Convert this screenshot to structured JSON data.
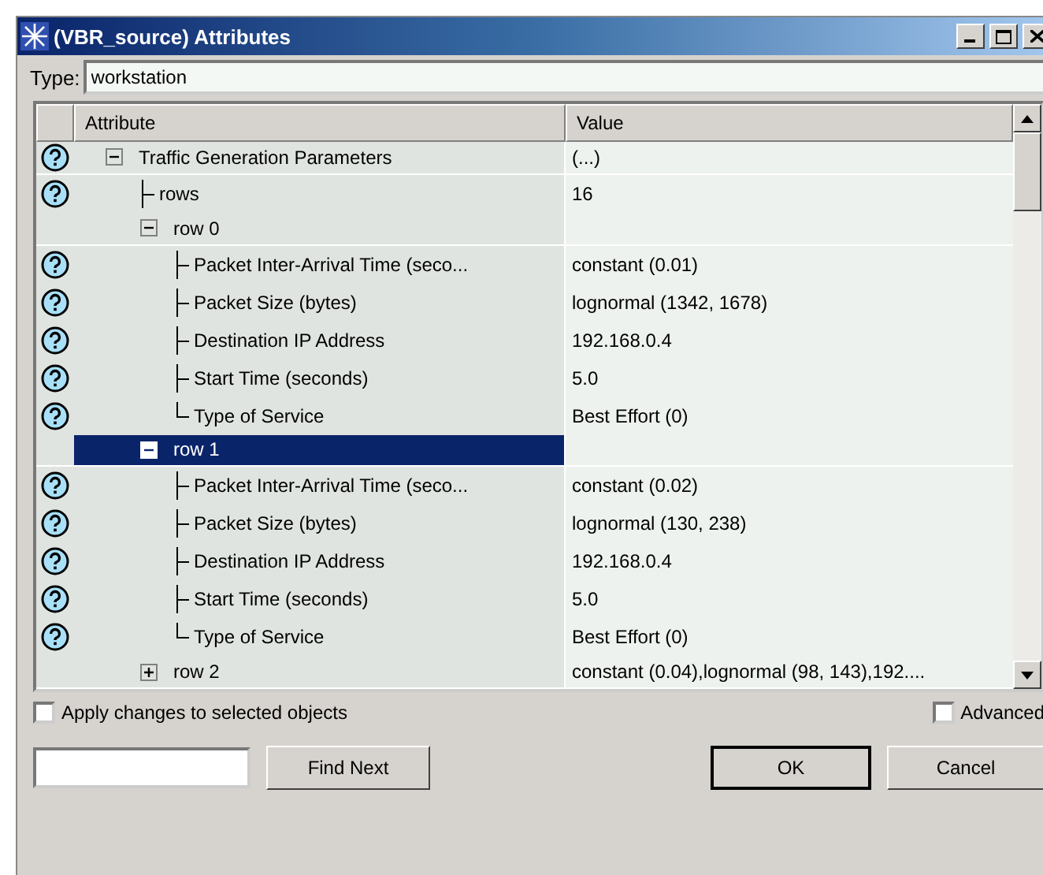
{
  "window": {
    "title": "(VBR_source) Attributes"
  },
  "type_field": {
    "label": "Type:",
    "value": "workstation"
  },
  "table": {
    "columns": [
      "Attribute",
      "Value"
    ],
    "rows": [
      {
        "label": "Traffic Generation Parameters",
        "value": "(...)",
        "help": true,
        "expanded": true,
        "selected": false,
        "children": [
          {
            "label": "rows",
            "value": "16",
            "help": true,
            "selected": false
          },
          {
            "label": "row 0",
            "help": false,
            "expanded": true,
            "selected": false,
            "children": [
              {
                "label": "Packet Inter-Arrival Time (seco...",
                "value": "constant (0.01)",
                "help": true,
                "selected": false
              },
              {
                "label": "Packet Size (bytes)",
                "value": "lognormal (1342, 1678)",
                "help": true,
                "selected": false
              },
              {
                "label": "Destination IP Address",
                "value": "192.168.0.4",
                "help": true,
                "selected": false
              },
              {
                "label": "Start Time (seconds)",
                "value": "5.0",
                "help": true,
                "selected": false
              },
              {
                "label": "Type of Service",
                "value": "Best Effort (0)",
                "help": true,
                "selected": false
              }
            ]
          },
          {
            "label": "row 1",
            "help": false,
            "expanded": true,
            "selected": true,
            "children": [
              {
                "label": "Packet Inter-Arrival Time (seco...",
                "value": "constant (0.02)",
                "help": true,
                "selected": false
              },
              {
                "label": "Packet Size (bytes)",
                "value": "lognormal (130, 238)",
                "help": true,
                "selected": false
              },
              {
                "label": "Destination IP Address",
                "value": "192.168.0.4",
                "help": true,
                "selected": false
              },
              {
                "label": "Start Time (seconds)",
                "value": "5.0",
                "help": true,
                "selected": false
              },
              {
                "label": "Type of Service",
                "value": "Best Effort (0)",
                "help": true,
                "selected": false
              }
            ]
          },
          {
            "label": "row 2",
            "value": "constant (0.04),lognormal (98, 143),192....",
            "help": false,
            "expanded": false,
            "selected": false
          }
        ]
      }
    ]
  },
  "apply_checkbox": {
    "label": "Apply changes to selected objects",
    "checked": false
  },
  "advanced_checkbox": {
    "label": "Advanced",
    "checked": false
  },
  "buttons": [
    "Find Next",
    "OK",
    "Cancel"
  ]
}
